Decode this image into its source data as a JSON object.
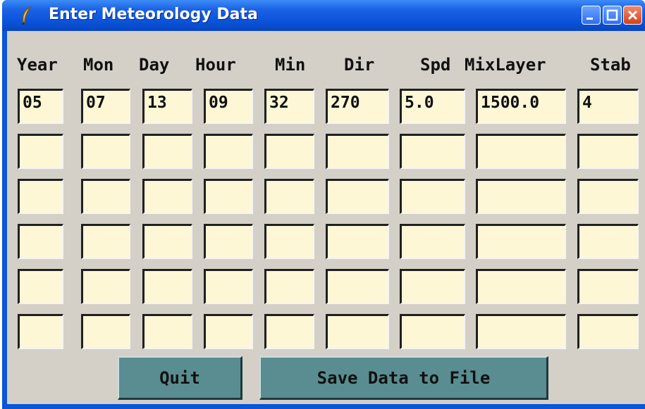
{
  "window": {
    "title": "Enter Meteorology Data",
    "icon": "feather-icon",
    "controls": [
      "minimize-icon",
      "maximize-icon",
      "close-icon"
    ]
  },
  "columns": [
    "Year",
    "Mon",
    "Day",
    "Hour",
    "Min",
    "Dir",
    "Spd",
    "MixLayer",
    "Stab"
  ],
  "rows": [
    [
      "05",
      "07",
      "13",
      "09",
      "32",
      "270",
      "5.0",
      "1500.0",
      "4"
    ],
    [
      "",
      "",
      "",
      "",
      "",
      "",
      "",
      "",
      ""
    ],
    [
      "",
      "",
      "",
      "",
      "",
      "",
      "",
      "",
      ""
    ],
    [
      "",
      "",
      "",
      "",
      "",
      "",
      "",
      "",
      ""
    ],
    [
      "",
      "",
      "",
      "",
      "",
      "",
      "",
      "",
      ""
    ],
    [
      "",
      "",
      "",
      "",
      "",
      "",
      "",
      "",
      ""
    ]
  ],
  "buttons": {
    "quit": "Quit",
    "save": "Save Data to File"
  },
  "colors": {
    "titlebar": "#0a55d8",
    "window_bg": "#d4d0c8",
    "entry_bg": "#fdf7d6",
    "button_bg": "#5a8d91"
  }
}
